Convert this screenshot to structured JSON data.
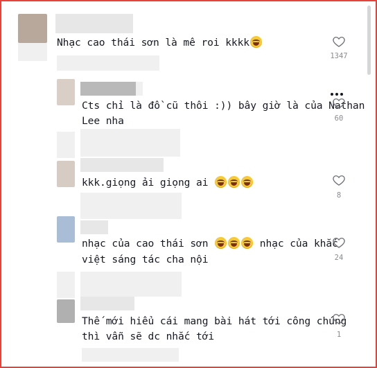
{
  "comments": [
    {
      "text": "Nhạc cao thái sơn là mê roi kkkk",
      "likes": "1347"
    },
    {
      "line1": "Cts chỉ là đồ cũ thôi :)) bây giờ là của Nathan",
      "line2": "Lee nha",
      "likes": "60"
    },
    {
      "text": "kkk.giọng ải giọng ai",
      "likes": "8"
    },
    {
      "line1": "nhạc của cao thái sơn",
      "line1b": "nhạc của khắc",
      "line2": "việt sáng tác cha nội",
      "likes": "24"
    },
    {
      "line1": "Thế mới hiểu cái mang bài hát tới công chúng",
      "line2": "thì vẫn sẽ dc nhắc tới",
      "likes": "1"
    }
  ],
  "icons": {
    "like": "heart-outline-icon",
    "more": "more-horizontal-icon",
    "emoji": "tears-of-joy-emoji"
  },
  "colors": {
    "frame": "#e8413a",
    "text": "#161823",
    "count": "#8a8b91"
  }
}
